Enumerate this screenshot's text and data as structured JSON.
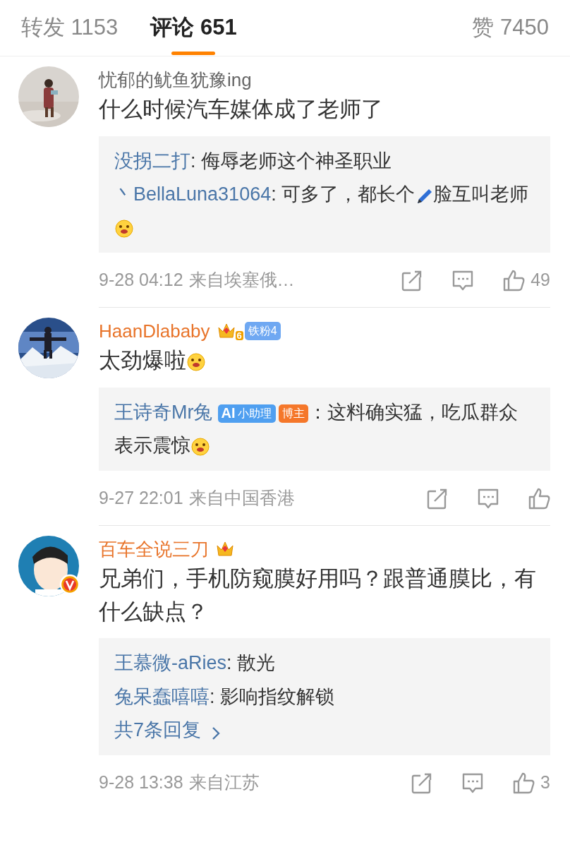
{
  "tabs": [
    {
      "label": "转发",
      "count": "1153",
      "selected": false
    },
    {
      "label": "评论",
      "count": "651",
      "selected": true
    },
    {
      "label": "赞",
      "count": "7450",
      "selected": false
    }
  ],
  "comments": [
    {
      "author": "忧郁的鱿鱼犹豫ing",
      "vip": false,
      "verified": false,
      "emoji": false,
      "text": "什么时候汽车媒体成了老师了",
      "replies": [
        {
          "author": "没拐二打",
          "parts": [
            {
              "kind": "text",
              "text": ": 侮辱老师这个神圣职业"
            }
          ]
        },
        {
          "author": "丶BellaLuna31064",
          "parts": [
            {
              "kind": "text",
              "text": ": 可多了，都长个"
            },
            {
              "kind": "pen"
            },
            {
              "kind": "text",
              "text": "脸互叫老师"
            },
            {
              "kind": "emoji"
            }
          ]
        }
      ],
      "time": "9-28 04:12",
      "location": "来自埃塞俄…",
      "likes": "49"
    },
    {
      "author": "HaanDlababy",
      "vip": true,
      "verified": false,
      "badges": [
        {
          "kind": "crown",
          "text": "6"
        },
        {
          "kind": "fan",
          "text": "铁粉4"
        }
      ],
      "text": "太劲爆啦",
      "emoji": true,
      "replies": [
        {
          "author": "王诗奇Mr兔",
          "badges": [
            {
              "kind": "ai",
              "mark": "AI",
              "text": "小助理"
            },
            {
              "kind": "host",
              "text": "博主"
            }
          ],
          "parts": [
            {
              "kind": "text",
              "text": "：这料确实猛，吃瓜群众表示震惊"
            },
            {
              "kind": "emoji"
            }
          ]
        }
      ],
      "time": "9-27 22:01",
      "location": "来自中国香港"
    },
    {
      "author": "百车全说三刀",
      "vip": true,
      "verified": true,
      "emoji": false,
      "badges": [
        {
          "kind": "crown"
        }
      ],
      "text": "兄弟们，手机防窥膜好用吗？跟普通膜比，有什么缺点？",
      "replies": [
        {
          "author": "王慕微-aRies",
          "parts": [
            {
              "kind": "text",
              "text": ": 散光"
            }
          ]
        },
        {
          "author": "兔呆蠢嘻嘻",
          "parts": [
            {
              "kind": "text",
              "text": ": 影响指纹解锁"
            }
          ]
        }
      ],
      "more": "共7条回复",
      "time": "9-28 13:38",
      "location": "来自江苏",
      "likes": "3"
    }
  ]
}
